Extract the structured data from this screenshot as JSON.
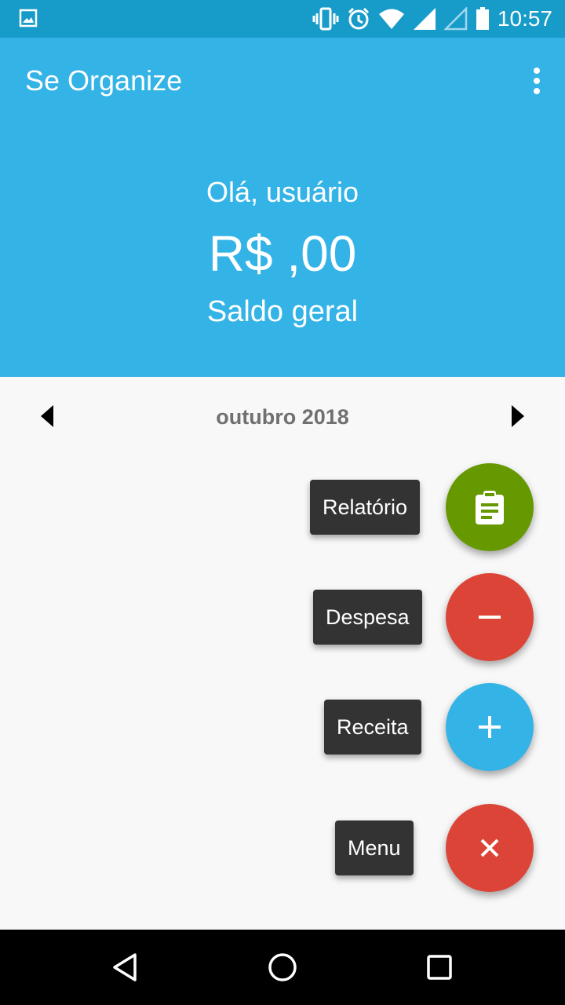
{
  "status_bar": {
    "time": "10:57",
    "icons": [
      "image-icon",
      "vibrate-icon",
      "alarm-icon",
      "wifi-icon",
      "signal-icon",
      "signal-empty-icon",
      "battery-icon"
    ]
  },
  "app_bar": {
    "title": "Se Organize",
    "menu_icon": "more-vert-icon"
  },
  "summary": {
    "greeting": "Olá, usuário",
    "balance": "R$ ,00",
    "balance_label": "Saldo geral"
  },
  "month_nav": {
    "label": "outubro 2018",
    "prev_icon": "arrow-left-icon",
    "next_icon": "arrow-right-icon"
  },
  "fab_menu": {
    "items": [
      {
        "label": "Relatório",
        "icon": "clipboard-icon",
        "color": "#669900"
      },
      {
        "label": "Despesa",
        "icon": "minus-icon",
        "color": "#db4437"
      },
      {
        "label": "Receita",
        "icon": "plus-icon",
        "color": "#33b3e6"
      },
      {
        "label": "Menu",
        "icon": "close-icon",
        "color": "#db4437"
      }
    ]
  },
  "colors": {
    "primary": "#33b3e6",
    "primary_dark": "#179bc9",
    "background": "#f8f8f8"
  },
  "nav_bar": {
    "icons": [
      "back-icon",
      "home-icon",
      "recents-icon"
    ]
  }
}
